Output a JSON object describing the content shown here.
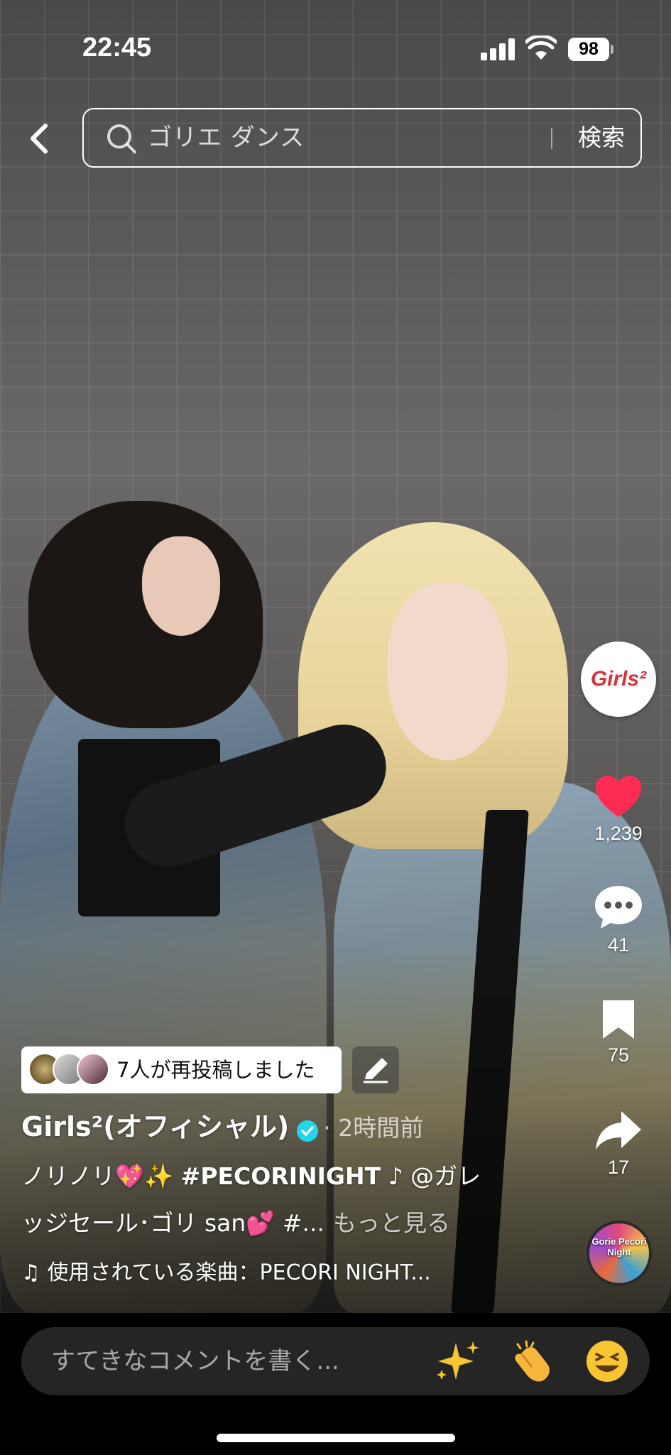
{
  "status_bar": {
    "time": "22:45",
    "battery": "98",
    "icons": [
      "signal-icon",
      "wifi-icon",
      "battery-icon"
    ]
  },
  "search": {
    "query": "ゴリエ ダンス",
    "button_label": "検索",
    "back_icon": "chevron-left-icon",
    "search_icon": "search-icon"
  },
  "right_rail": {
    "creator_logo": "Girls²",
    "likes": "1,239",
    "comments": "41",
    "saves": "75",
    "shares": "17",
    "music_disc_label": "Gorie Pecori Night",
    "like_color": "#fe2c55"
  },
  "repost": {
    "text": "7人が再投稿しました",
    "edit_icon": "pencil-icon"
  },
  "caption": {
    "author": "Girls²(オフィシャル)",
    "time": "· 2時間前",
    "line1_prefix": "ノリノリ💖✨ ",
    "line1_hashtag": "#PECORINIGHT",
    "line1_suffix": " ♪ @ガレ",
    "line2": "ッジセール･ゴリ san💕 #...",
    "more": "もっと見る",
    "music": "♫ 使用されている楽曲：PECORI NIGHT..."
  },
  "comment_bar": {
    "placeholder": "すてきなコメントを書く...",
    "emojis": [
      "✨",
      "👏",
      "😆"
    ]
  }
}
